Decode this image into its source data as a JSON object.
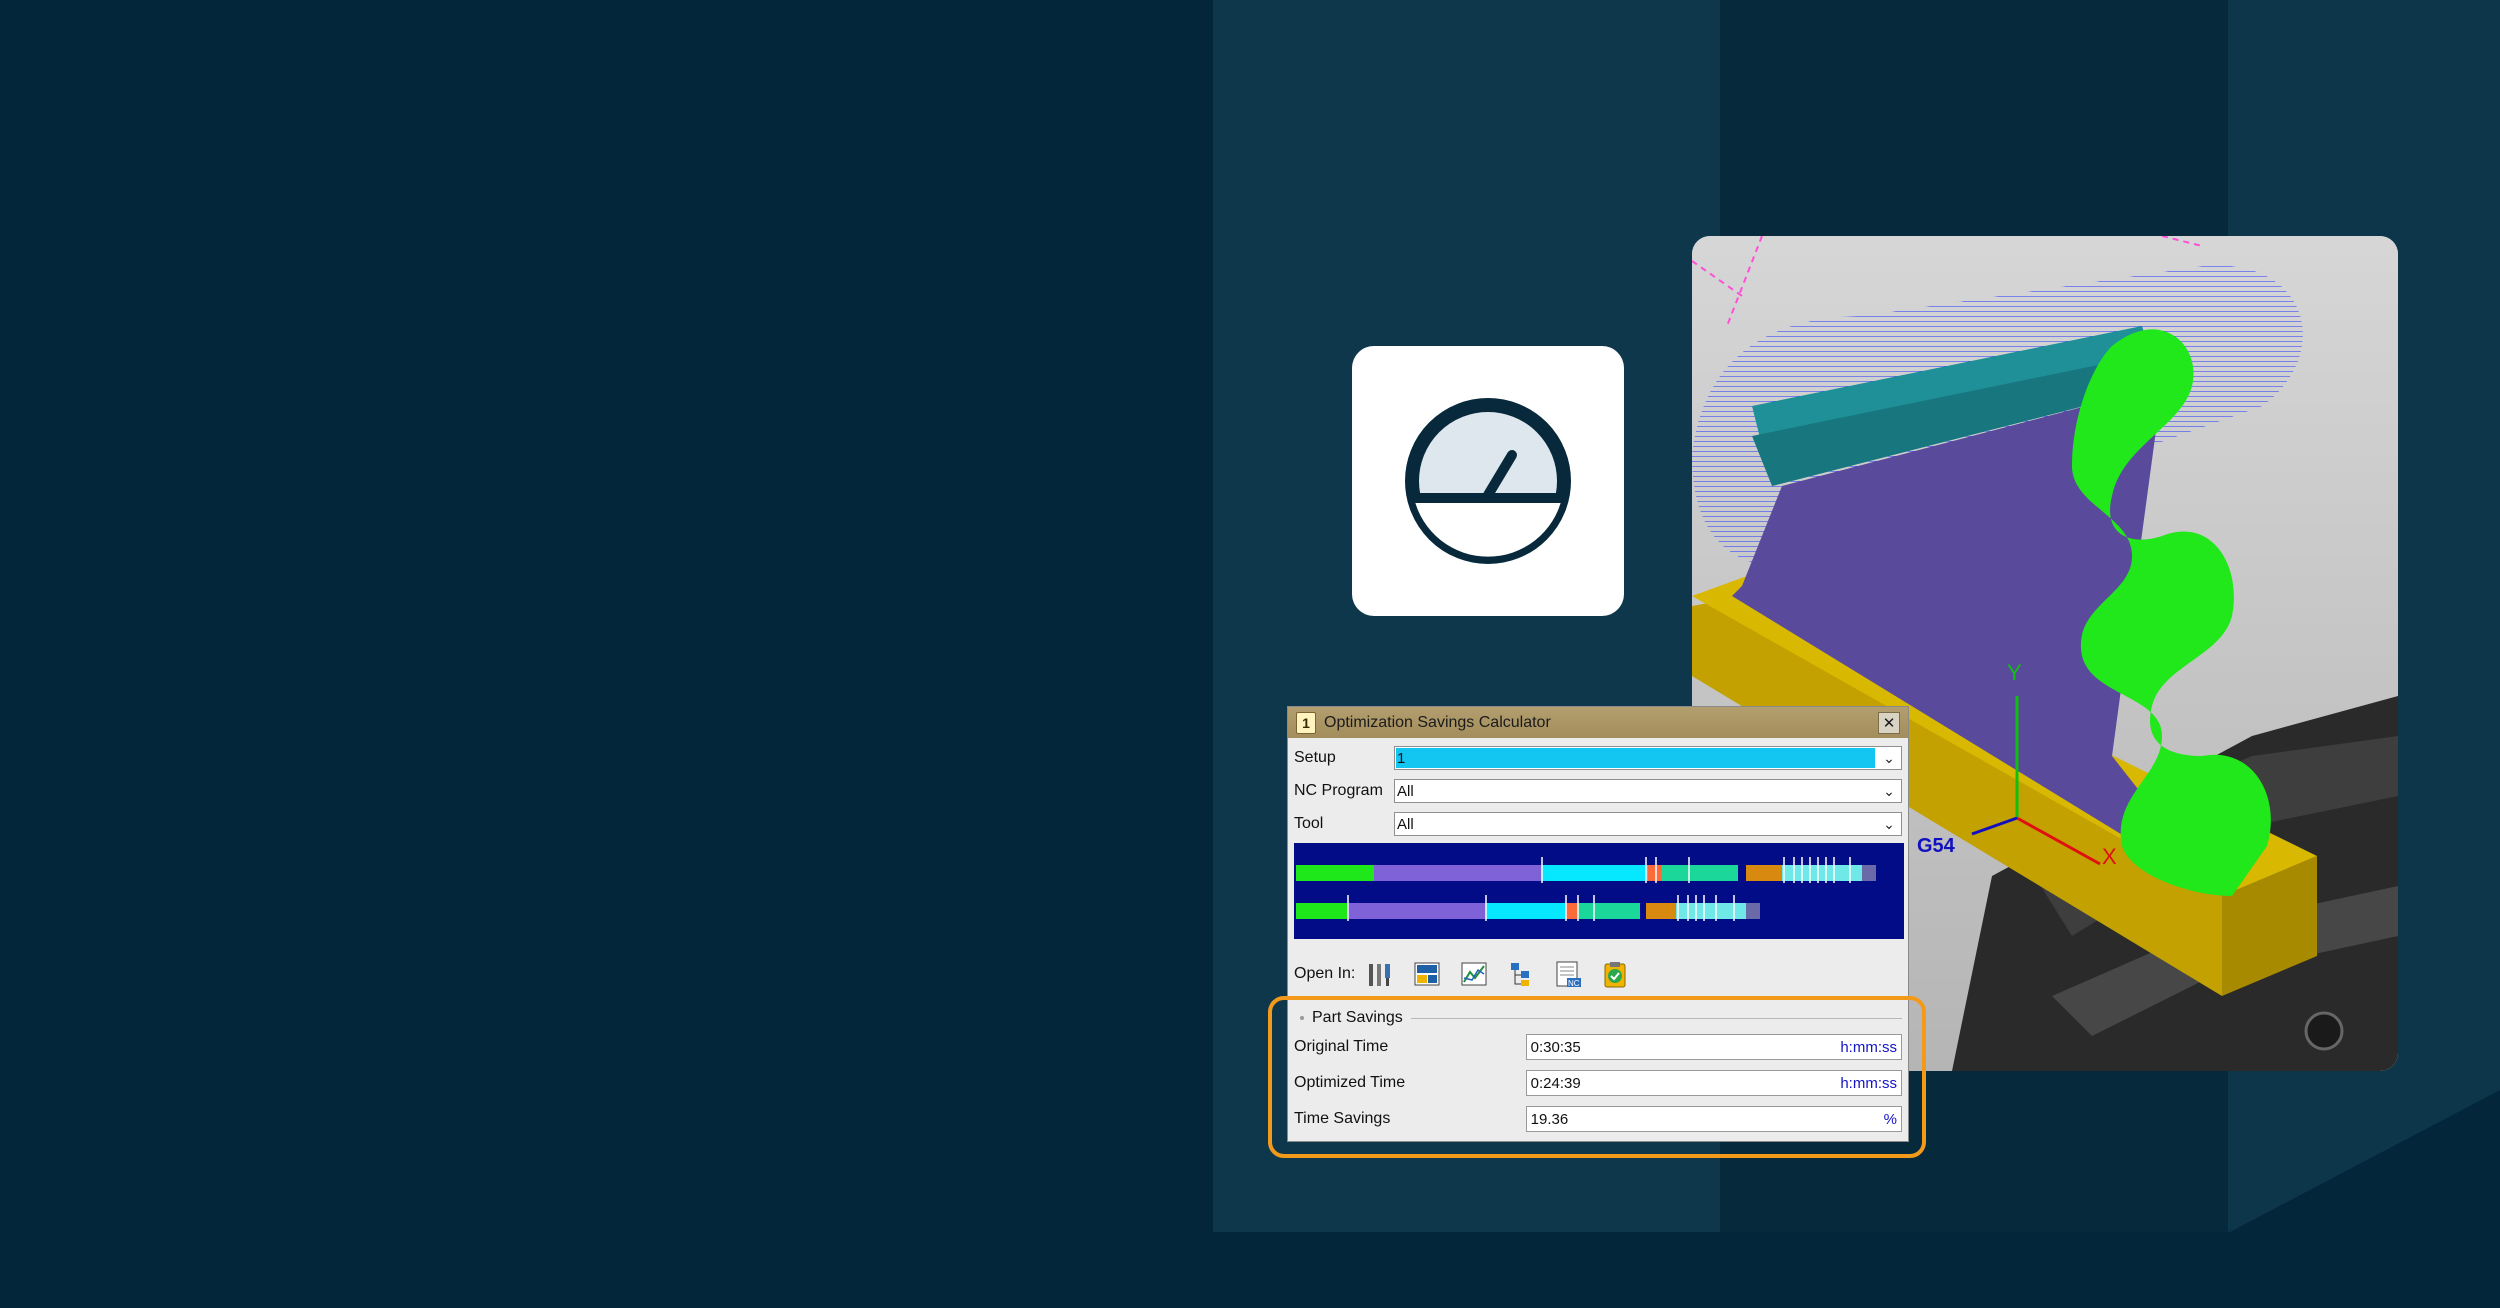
{
  "colors": {
    "background": "#03263a",
    "accent_highlight": "#f39a1b",
    "dialog_titlebar": "#a38d5c",
    "timeline_bg": "#020c86"
  },
  "icon_card": {
    "icon": "gauge-icon"
  },
  "cad_view": {
    "axis_y": "Y",
    "axis_x": "X",
    "origin_label": "G54"
  },
  "dialog": {
    "title": "Optimization Savings Calculator",
    "close_icon": "close-icon",
    "fields": [
      {
        "label": "Setup",
        "value": "1"
      },
      {
        "label": "NC Program",
        "value": "All"
      },
      {
        "label": "Tool",
        "value": "All"
      }
    ],
    "open_in_label": "Open In:",
    "open_in_icons": [
      "tool-manager-icon",
      "layout-view-icon",
      "chart-icon",
      "tree-icon",
      "nc-program-icon",
      "clipboard-check-icon"
    ],
    "part_savings": {
      "title": "Part Savings",
      "rows": [
        {
          "label": "Original Time",
          "value": "0:30:35",
          "unit": "h:mm:ss"
        },
        {
          "label": "Optimized Time",
          "value": "0:24:39",
          "unit": "h:mm:ss"
        },
        {
          "label": "Time Savings",
          "value": "19.36",
          "unit": "%"
        }
      ]
    }
  }
}
